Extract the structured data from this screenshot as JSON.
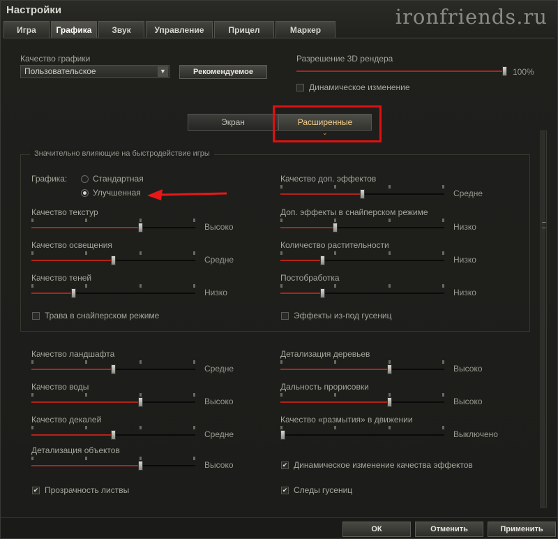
{
  "window": {
    "title": "Настройки",
    "watermark": "ironfriends.ru"
  },
  "tabs": [
    "Игра",
    "Графика",
    "Звук",
    "Управление",
    "Прицел",
    "Маркер"
  ],
  "active_tab": 1,
  "quality": {
    "label": "Качество графики",
    "value": "Пользовательское",
    "recommended_button": "Рекомендуемое"
  },
  "render": {
    "label": "Разрешение 3D рендера",
    "value": 1.0,
    "percent": "100%",
    "dynamic_label": "Динамическое изменение",
    "dynamic_checked": false
  },
  "subtabs": [
    "Экран",
    "Расширенные"
  ],
  "active_subtab": 1,
  "panel_title": "Значительно влияющие на быстродействие игры",
  "graphics_mode": {
    "label": "Графика:",
    "options": [
      "Стандартная",
      "Улучшенная"
    ],
    "selected": 1
  },
  "sliders": [
    {
      "label": "Качество текстур",
      "value": 0.67,
      "value_text": "Высоко"
    },
    {
      "label": "Качество освещения",
      "value": 0.5,
      "value_text": "Средне"
    },
    {
      "label": "Качество теней",
      "value": 0.25,
      "value_text": "Низко"
    },
    {
      "label": "Качество доп. эффектов",
      "value": 0.5,
      "value_text": "Средне"
    },
    {
      "label": "Доп. эффекты в снайперском режиме",
      "value": 0.33,
      "value_text": "Низко"
    },
    {
      "label": "Количество растительности",
      "value": 0.25,
      "value_text": "Низко"
    },
    {
      "label": "Постобработка",
      "value": 0.25,
      "value_text": "Низко"
    },
    {
      "label": "Качество ландшафта",
      "value": 0.5,
      "value_text": "Средне"
    },
    {
      "label": "Качество воды",
      "value": 0.67,
      "value_text": "Высоко"
    },
    {
      "label": "Качество декалей",
      "value": 0.5,
      "value_text": "Средне"
    },
    {
      "label": "Детализация объектов",
      "value": 0.67,
      "value_text": "Высоко"
    },
    {
      "label": "Детализация деревьев",
      "value": 0.67,
      "value_text": "Высоко"
    },
    {
      "label": "Дальность прорисовки",
      "value": 0.67,
      "value_text": "Высоко"
    },
    {
      "label": "Качество «размытия» в движении",
      "value": 0.0,
      "value_text": "Выключено"
    }
  ],
  "checkboxes": [
    {
      "label": "Трава в снайперском режиме",
      "checked": false
    },
    {
      "label": "Эффекты из-под гусениц",
      "checked": false
    },
    {
      "label": "Прозрачность листвы",
      "checked": true
    },
    {
      "label": "Динамическое изменение качества эффектов",
      "checked": true
    },
    {
      "label": "Следы гусениц",
      "checked": true
    }
  ],
  "buttons": {
    "ok": "ОК",
    "cancel": "Отменить",
    "apply": "Применить"
  },
  "colors": {
    "highlight": "#e01010",
    "slider_fill": "#b02418",
    "active_subtab_text": "#f4d08a"
  }
}
